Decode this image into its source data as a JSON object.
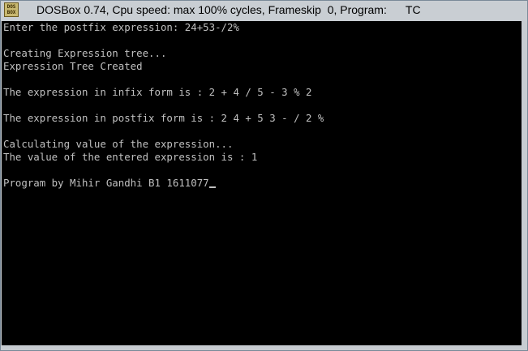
{
  "window": {
    "title": "DOSBox 0.74, Cpu speed: max 100% cycles, Frameskip  0, Program:      TC",
    "icon_name": "dosbox-icon",
    "icon_text": "DOS BOX"
  },
  "console": {
    "lines": [
      "Enter the postfix expression: 24+53-/2%",
      "",
      "Creating Expression tree...",
      "Expression Tree Created",
      "",
      "The expression in infix form is : 2 + 4 / 5 - 3 % 2",
      "",
      "The expression in postfix form is : 2 4 + 5 3 - / 2 %",
      "",
      "Calculating value of the expression...",
      "The value of the entered expression is : 1",
      "",
      "Program by Mihir Gandhi B1 1611077"
    ],
    "text_color": "#c0c0c0",
    "background_color": "#000000"
  }
}
